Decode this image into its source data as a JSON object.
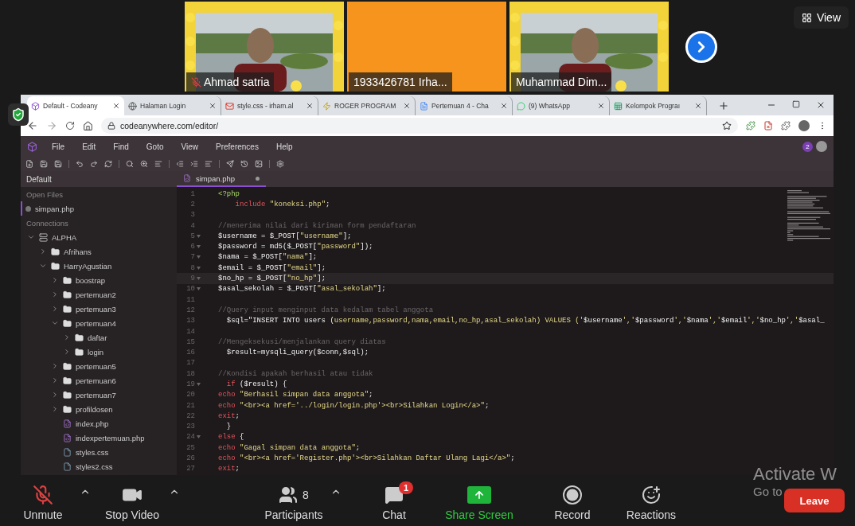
{
  "gallery": {
    "tiles": [
      {
        "name": "Ahmad satria",
        "kind": "picture",
        "muted": true
      },
      {
        "name": "1933426781 Irha...",
        "kind": "plain",
        "muted": false
      },
      {
        "name": "Muhammad Dim...",
        "kind": "picture",
        "muted": false
      }
    ],
    "view_button": "View"
  },
  "browser": {
    "tabs": [
      {
        "title": "Default - Codeany",
        "selected": true
      },
      {
        "title": "Halaman Login",
        "selected": false
      },
      {
        "title": "style.css - irham.al",
        "selected": false
      },
      {
        "title": "ROGER PROGRAM",
        "selected": false
      },
      {
        "title": "Pertemuan 4 - Cha",
        "selected": false
      },
      {
        "title": "(9) WhatsApp",
        "selected": false
      },
      {
        "title": "Kelompok Prograı",
        "selected": false
      }
    ],
    "address": "codeanywhere.com/editor/"
  },
  "editor": {
    "menu": [
      "File",
      "Edit",
      "Find",
      "Goto",
      "View",
      "Preferences",
      "Help"
    ],
    "notification_count": "2",
    "sidebar": {
      "header": "Default",
      "open_files_label": "Open Files",
      "open_files": [
        {
          "name": "simpan.php",
          "selected": true
        }
      ],
      "connections_label": "Connections",
      "tree": [
        {
          "name": "ALPHA",
          "kind": "server",
          "expanded": true,
          "children": [
            {
              "name": "Afrihans",
              "kind": "folder",
              "expanded": false
            },
            {
              "name": "HarryAgustian",
              "kind": "folder",
              "expanded": true,
              "children": [
                {
                  "name": "boostrap",
                  "kind": "folder",
                  "expanded": false
                },
                {
                  "name": "pertemuan2",
                  "kind": "folder",
                  "expanded": false
                },
                {
                  "name": "pertemuan3",
                  "kind": "folder",
                  "expanded": false
                },
                {
                  "name": "pertemuan4",
                  "kind": "folder",
                  "expanded": true,
                  "children": [
                    {
                      "name": "daftar",
                      "kind": "folder",
                      "expanded": false
                    },
                    {
                      "name": "login",
                      "kind": "folder",
                      "expanded": false
                    }
                  ]
                },
                {
                  "name": "pertemuan5",
                  "kind": "folder",
                  "expanded": false
                },
                {
                  "name": "pertemuan6",
                  "kind": "folder",
                  "expanded": false
                },
                {
                  "name": "pertemuan7",
                  "kind": "folder",
                  "expanded": false
                },
                {
                  "name": "profildosen",
                  "kind": "folder",
                  "expanded": false
                },
                {
                  "name": "index.php",
                  "kind": "php"
                },
                {
                  "name": "indexpertemuan.php",
                  "kind": "php"
                },
                {
                  "name": "styles.css",
                  "kind": "css"
                },
                {
                  "name": "styles2.css",
                  "kind": "css"
                }
              ]
            }
          ]
        }
      ]
    },
    "tab": {
      "name": "simpan.php",
      "modified": true
    },
    "lines": [
      {
        "number": "1",
        "tokens": [
          {
            "kind": "tag",
            "text": "<?php"
          }
        ]
      },
      {
        "number": "2",
        "tokens": [
          {
            "kind": "keyword",
            "text": "    include"
          },
          {
            "kind": "string",
            "text": " \"koneksi.php\""
          },
          {
            "kind": "plain",
            "text": ";"
          }
        ]
      },
      {
        "number": "3"
      },
      {
        "number": "4",
        "tokens": [
          {
            "kind": "comment",
            "text": "//menerima nilai dari kiriman form pendaftaran"
          }
        ]
      },
      {
        "number": "5",
        "fold": true,
        "tokens": [
          {
            "kind": "plain",
            "text": "$username = $_POST["
          },
          {
            "kind": "string",
            "text": "\"username\""
          },
          {
            "kind": "plain",
            "text": "];"
          }
        ]
      },
      {
        "number": "6",
        "fold": true,
        "tokens": [
          {
            "kind": "plain",
            "text": "$password = md5($_POST["
          },
          {
            "kind": "string",
            "text": "\"password\""
          },
          {
            "kind": "plain",
            "text": "]);"
          }
        ]
      },
      {
        "number": "7",
        "fold": true,
        "tokens": [
          {
            "kind": "plain",
            "text": "$nama = $_POST["
          },
          {
            "kind": "string",
            "text": "\"nama\""
          },
          {
            "kind": "plain",
            "text": "];"
          }
        ]
      },
      {
        "number": "8",
        "fold": true,
        "tokens": [
          {
            "kind": "plain",
            "text": "$email = $_POST["
          },
          {
            "kind": "string",
            "text": "\"email\""
          },
          {
            "kind": "plain",
            "text": "];"
          }
        ]
      },
      {
        "number": "9",
        "fold": true,
        "current": true,
        "tokens": [
          {
            "kind": "plain",
            "text": "$no_hp = $_POST["
          },
          {
            "kind": "string",
            "text": "\"no_hp\""
          },
          {
            "kind": "plain",
            "text": "];"
          }
        ]
      },
      {
        "number": "10",
        "fold": true,
        "tokens": [
          {
            "kind": "plain",
            "text": "$asal_sekolah = $_POST["
          },
          {
            "kind": "string",
            "text": "\"asal_sekolah\""
          },
          {
            "kind": "plain",
            "text": "];"
          }
        ]
      },
      {
        "number": "11"
      },
      {
        "number": "12",
        "tokens": [
          {
            "kind": "comment",
            "text": "//Query input menginput data kedalam tabel anggota"
          }
        ]
      },
      {
        "number": "13",
        "tokens": [
          {
            "kind": "plain",
            "text": "  $sql=\"INSERT INTO users ("
          },
          {
            "kind": "string",
            "text": "username,password,nama,email,no_hp,asal_sekolah) VALUES ('"
          },
          {
            "kind": "plain",
            "text": "$username"
          },
          {
            "kind": "string",
            "text": "','"
          },
          {
            "kind": "plain",
            "text": "$password"
          },
          {
            "kind": "string",
            "text": "','"
          },
          {
            "kind": "plain",
            "text": "$nama"
          },
          {
            "kind": "string",
            "text": "','"
          },
          {
            "kind": "plain",
            "text": "$email"
          },
          {
            "kind": "string",
            "text": "','"
          },
          {
            "kind": "plain",
            "text": "$no_hp"
          },
          {
            "kind": "string",
            "text": "','"
          },
          {
            "kind": "plain",
            "text": "$asal_"
          }
        ]
      },
      {
        "number": "14"
      },
      {
        "number": "15",
        "tokens": [
          {
            "kind": "comment",
            "text": "//Mengeksekusi/menjalankan query diatas"
          }
        ]
      },
      {
        "number": "16",
        "tokens": [
          {
            "kind": "plain",
            "text": "  $result=mysqli_query($conn,$sql);"
          }
        ]
      },
      {
        "number": "17"
      },
      {
        "number": "18",
        "tokens": [
          {
            "kind": "comment",
            "text": "//Kondisi apakah berhasil atau tidak"
          }
        ]
      },
      {
        "number": "19",
        "fold": true,
        "tokens": [
          {
            "kind": "keyword",
            "text": "  if"
          },
          {
            "kind": "plain",
            "text": " ($result) {"
          }
        ]
      },
      {
        "number": "20",
        "tokens": [
          {
            "kind": "keyword",
            "text": "echo"
          },
          {
            "kind": "string",
            "text": " \"Berhasil simpan data anggota\""
          },
          {
            "kind": "plain",
            "text": ";"
          }
        ]
      },
      {
        "number": "21",
        "tokens": [
          {
            "kind": "keyword",
            "text": "echo"
          },
          {
            "kind": "string",
            "text": " \"<br><a href='../login/login.php'><br>Silahkan Login</a>\""
          },
          {
            "kind": "plain",
            "text": ";"
          }
        ]
      },
      {
        "number": "22",
        "tokens": [
          {
            "kind": "keyword",
            "text": "exit"
          },
          {
            "kind": "plain",
            "text": ";"
          }
        ]
      },
      {
        "number": "23",
        "tokens": [
          {
            "kind": "plain",
            "text": "  }"
          }
        ]
      },
      {
        "number": "24",
        "fold": true,
        "tokens": [
          {
            "kind": "keyword",
            "text": "else"
          },
          {
            "kind": "plain",
            "text": " {"
          }
        ]
      },
      {
        "number": "25",
        "tokens": [
          {
            "kind": "keyword",
            "text": "echo"
          },
          {
            "kind": "string",
            "text": " \"Gagal simpan data anggota\""
          },
          {
            "kind": "plain",
            "text": ";"
          }
        ]
      },
      {
        "number": "26",
        "tokens": [
          {
            "kind": "keyword",
            "text": "echo"
          },
          {
            "kind": "string",
            "text": " \"<br><a href='Register.php'><br>Silahkan Daftar Ulang Lagi</a>\""
          },
          {
            "kind": "plain",
            "text": ";"
          }
        ]
      },
      {
        "number": "27",
        "tokens": [
          {
            "kind": "keyword",
            "text": "exit"
          },
          {
            "kind": "plain",
            "text": ";"
          }
        ]
      }
    ]
  },
  "meeting_controls": {
    "controls": [
      {
        "label": "Unmute",
        "kind": "mic",
        "muted": true,
        "menu": true
      },
      {
        "label": "Stop Video",
        "kind": "video",
        "menu": true
      },
      {
        "label": "Participants",
        "kind": "participants",
        "count": "8",
        "menu": true
      },
      {
        "label": "Chat",
        "kind": "chat",
        "badge": "1"
      },
      {
        "label": "Share Screen",
        "kind": "share"
      },
      {
        "label": "Record",
        "kind": "record"
      },
      {
        "label": "Reactions",
        "kind": "reactions"
      }
    ],
    "leave": "Leave"
  },
  "os_notice": [
    "Activate W",
    "Go to"
  ]
}
